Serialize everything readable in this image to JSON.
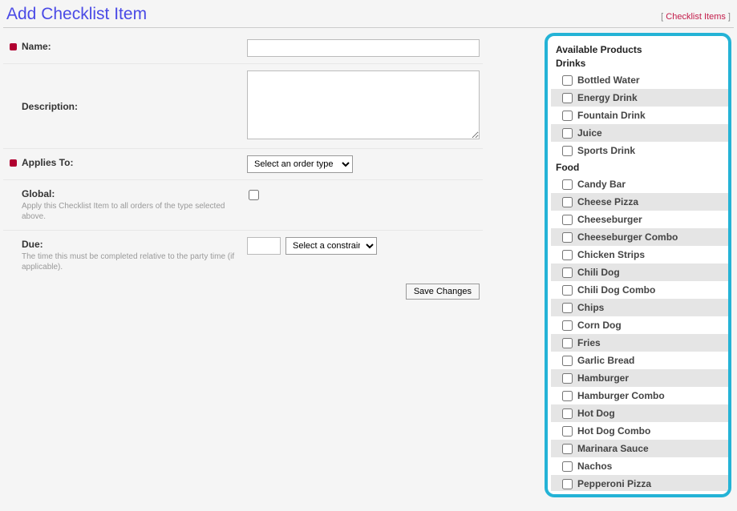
{
  "header": {
    "title": "Add Checklist Item",
    "link_text": "Checklist Items"
  },
  "form": {
    "name": {
      "label": "Name:"
    },
    "description": {
      "label": "Description:"
    },
    "applies": {
      "label": "Applies To:",
      "select_placeholder": "Select an order type"
    },
    "global": {
      "label": "Global:",
      "sub": "Apply this Checklist Item to all orders of the type selected above."
    },
    "due": {
      "label": "Due:",
      "sub": "The time this must be completed relative to the party time (if applicable).",
      "constraint_placeholder": "Select a constraint"
    },
    "save_label": "Save Changes"
  },
  "side": {
    "title": "Available Products",
    "groups": [
      {
        "name": "Drinks",
        "items": [
          "Bottled Water",
          "Energy Drink",
          "Fountain Drink",
          "Juice",
          "Sports Drink"
        ]
      },
      {
        "name": "Food",
        "items": [
          "Candy Bar",
          "Cheese Pizza",
          "Cheeseburger",
          "Cheeseburger Combo",
          "Chicken Strips",
          "Chili Dog",
          "Chili Dog Combo",
          "Chips",
          "Corn Dog",
          "Fries",
          "Garlic Bread",
          "Hamburger",
          "Hamburger Combo",
          "Hot Dog",
          "Hot Dog Combo",
          "Marinara Sauce",
          "Nachos",
          "Pepperoni Pizza"
        ]
      }
    ]
  }
}
